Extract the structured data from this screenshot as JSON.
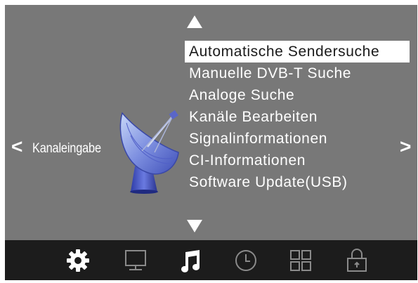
{
  "section": {
    "label": "Kanaleingabe",
    "prev_symbol": "<",
    "next_symbol": ">"
  },
  "menu": {
    "items": [
      {
        "label": "Automatische Sendersuche",
        "selected": true
      },
      {
        "label": "Manuelle DVB-T Suche",
        "selected": false
      },
      {
        "label": "Analoge Suche",
        "selected": false
      },
      {
        "label": "Kanäle Bearbeiten",
        "selected": false
      },
      {
        "label": "Signalinformationen",
        "selected": false
      },
      {
        "label": "CI-Informationen",
        "selected": false
      },
      {
        "label": "Software Update(USB)",
        "selected": false
      }
    ]
  },
  "taskbar": {
    "icons": [
      {
        "name": "settings-gear-icon",
        "active": true
      },
      {
        "name": "monitor-icon",
        "active": false
      },
      {
        "name": "music-note-icon",
        "active": true
      },
      {
        "name": "clock-icon",
        "active": false
      },
      {
        "name": "grid-apps-icon",
        "active": false
      },
      {
        "name": "lock-icon",
        "active": false
      }
    ]
  },
  "colors": {
    "background": "#787878",
    "taskbar": "#1c1c1c",
    "highlight": "#ffffff",
    "text": "#ffffff"
  }
}
